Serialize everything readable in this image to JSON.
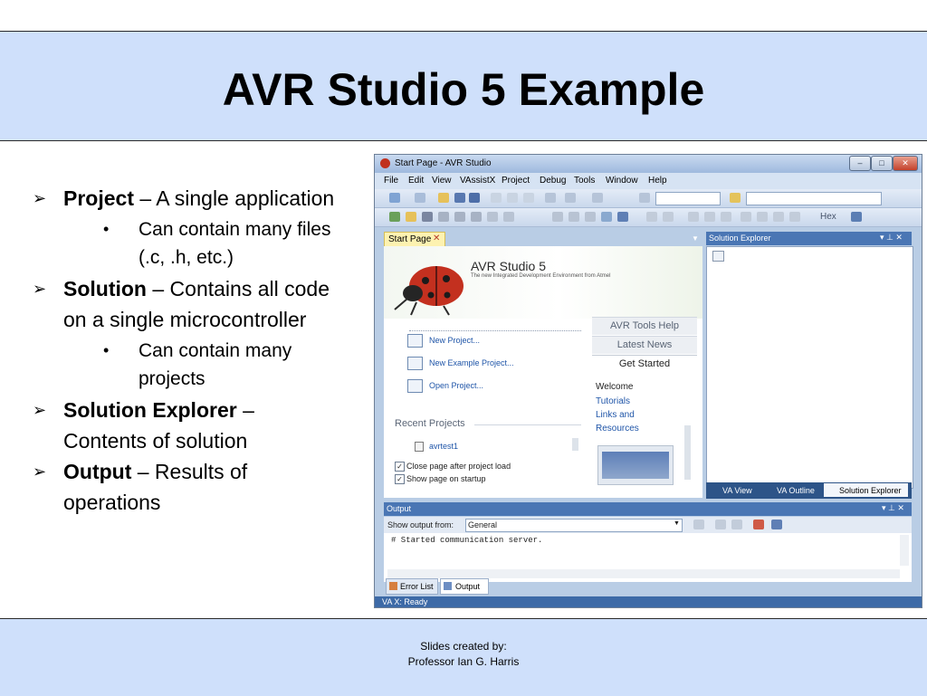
{
  "slide": {
    "title": "AVR Studio 5 Example",
    "bullets": [
      {
        "term": "Project",
        "desc": " – A single application"
      },
      {
        "sub": "Can contain many files (.c, .h, etc.)"
      },
      {
        "term": "Solution",
        "desc": " – Contains all code on a single microcontroller"
      },
      {
        "sub": "Can contain many projects"
      },
      {
        "term": "Solution Explorer",
        "desc": " – Contents of solution"
      },
      {
        "term": "Output",
        "desc": " – Results of operations"
      }
    ],
    "footer": {
      "line1": "Slides created by:",
      "line2": "Professor Ian G. Harris"
    }
  },
  "app": {
    "window_title": "Start Page - AVR Studio",
    "menu": [
      "File",
      "Edit",
      "View",
      "VAssistX",
      "Project",
      "Debug",
      "Tools",
      "Window",
      "Help"
    ],
    "toolbar": {
      "hex_label": "Hex"
    },
    "start_page": {
      "tab_label": "Start Page",
      "brand": "AVR Studio 5",
      "tagline": "The new Integrated Development Environment from Atmel",
      "actions": [
        "New Project...",
        "New Example Project...",
        "Open Project..."
      ],
      "side_tabs": [
        "AVR Tools Help",
        "Latest News",
        "Get Started"
      ],
      "get_started_links": [
        "Welcome",
        "Tutorials",
        "Links and",
        "Resources"
      ],
      "recent_projects_heading": "Recent Projects",
      "recent_projects": [
        "avrtest1"
      ],
      "checkboxes": [
        {
          "label": "Close page after project load",
          "checked": true
        },
        {
          "label": "Show page on startup",
          "checked": true
        }
      ]
    },
    "solution_explorer": {
      "title": "Solution Explorer",
      "bottom_tabs": [
        "VA View",
        "VA Outline",
        "Solution Explorer"
      ]
    },
    "output": {
      "title": "Output",
      "show_from_label": "Show output from:",
      "show_from_value": "General",
      "text": "# Started communication server."
    },
    "bottom_tabs": [
      "Error List",
      "Output"
    ],
    "status_text": "VA X: Ready"
  },
  "colors": {
    "title_band": "#cfe0fb",
    "panel_header": "#3f69a6",
    "link": "#1f55a8"
  },
  "icons": [
    "bullet-arrow-icon",
    "bullet-dot-icon",
    "ladybug-logo-icon",
    "close-icon",
    "minimize-icon",
    "maximize-icon",
    "pin-icon",
    "dropdown-arrow-icon"
  ]
}
